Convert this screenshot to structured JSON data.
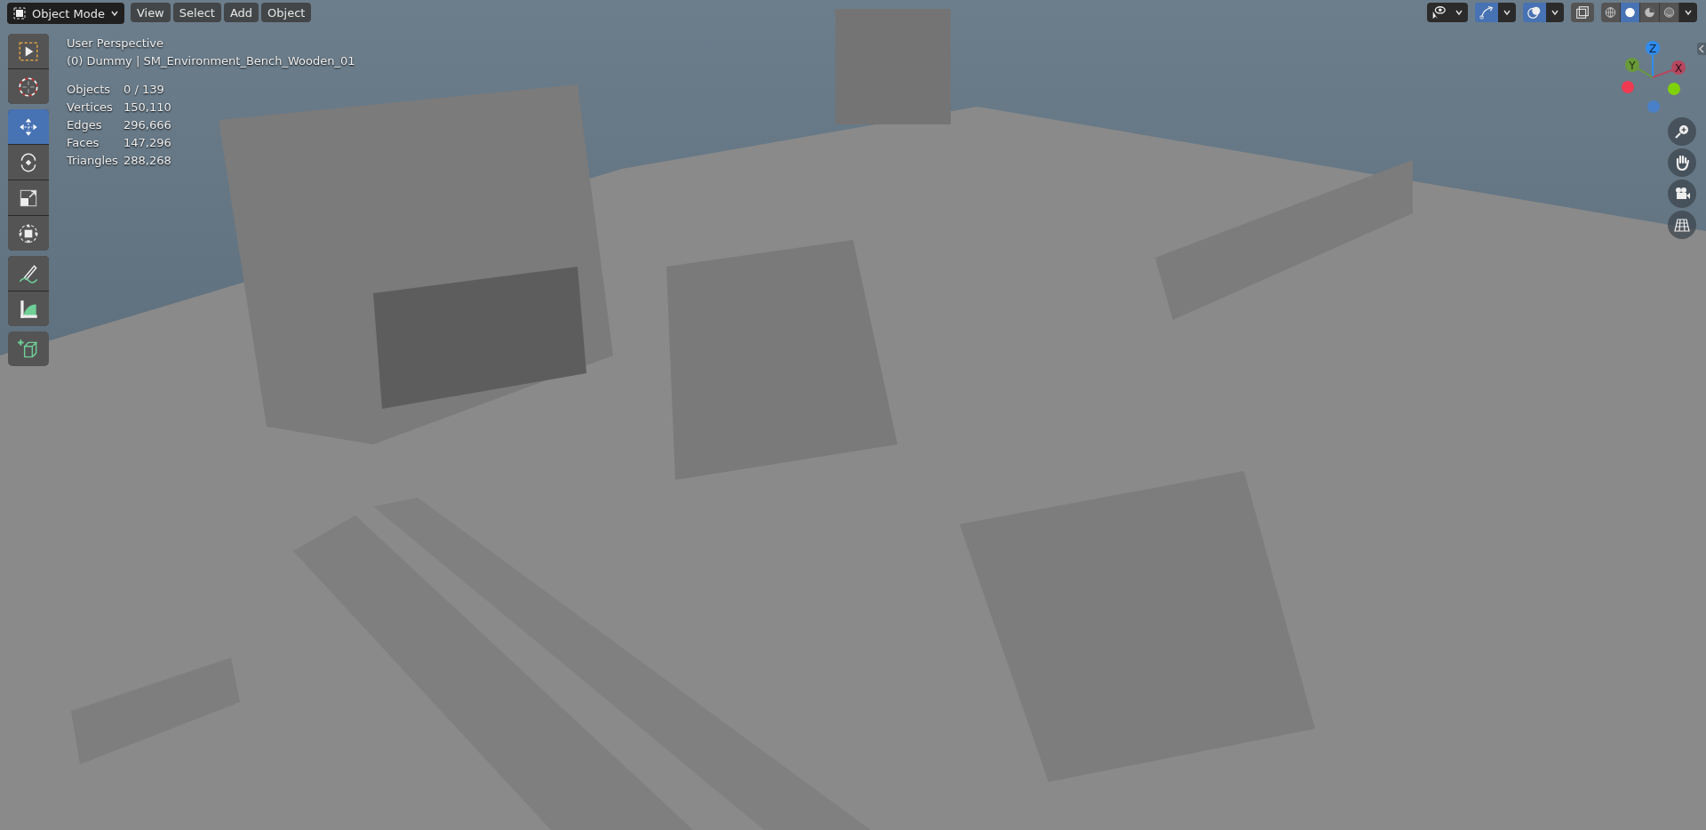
{
  "header": {
    "mode": "Object Mode",
    "menus": [
      "View",
      "Select",
      "Add",
      "Object"
    ],
    "toggles": [
      {
        "kind": "visibility",
        "on": false,
        "dropdown": true
      },
      {
        "kind": "gizmo",
        "on": true,
        "dropdown": true
      },
      {
        "kind": "overlay",
        "on": true,
        "dropdown": true
      },
      {
        "kind": "xray",
        "on": false,
        "dropdown": false
      }
    ],
    "shading": [
      {
        "kind": "wireframe",
        "selected": false
      },
      {
        "kind": "solid",
        "selected": true
      },
      {
        "kind": "material",
        "selected": false
      },
      {
        "kind": "rendered",
        "selected": false
      }
    ]
  },
  "tool_groups": [
    [
      {
        "kind": "select",
        "selected": false
      },
      {
        "kind": "cursor",
        "selected": false
      }
    ],
    [
      {
        "kind": "move",
        "selected": true
      },
      {
        "kind": "rotate",
        "selected": false
      },
      {
        "kind": "scale",
        "selected": false
      },
      {
        "kind": "transform",
        "selected": false
      }
    ],
    [
      {
        "kind": "annotate",
        "selected": false
      },
      {
        "kind": "measure",
        "selected": false
      }
    ],
    [
      {
        "kind": "add-cube",
        "selected": false
      }
    ]
  ],
  "viewport": {
    "view_name": "User Perspective",
    "object_line": "(0) Dummy | SM_Environment_Bench_Wooden_01",
    "stats": [
      {
        "label": "Objects",
        "value": "0 / 139"
      },
      {
        "label": "Vertices",
        "value": "150,110"
      },
      {
        "label": "Edges",
        "value": "296,666"
      },
      {
        "label": "Faces",
        "value": "147,296"
      },
      {
        "label": "Triangles",
        "value": "288,268"
      }
    ]
  },
  "axis_gizmo": {
    "labels": [
      {
        "kind": "z",
        "text": "Z"
      },
      {
        "kind": "y",
        "text": "Y"
      },
      {
        "kind": "x",
        "text": "X"
      }
    ]
  },
  "nav_buttons": [
    {
      "kind": "zoom"
    },
    {
      "kind": "pan"
    },
    {
      "kind": "camera"
    },
    {
      "kind": "ortho"
    }
  ]
}
